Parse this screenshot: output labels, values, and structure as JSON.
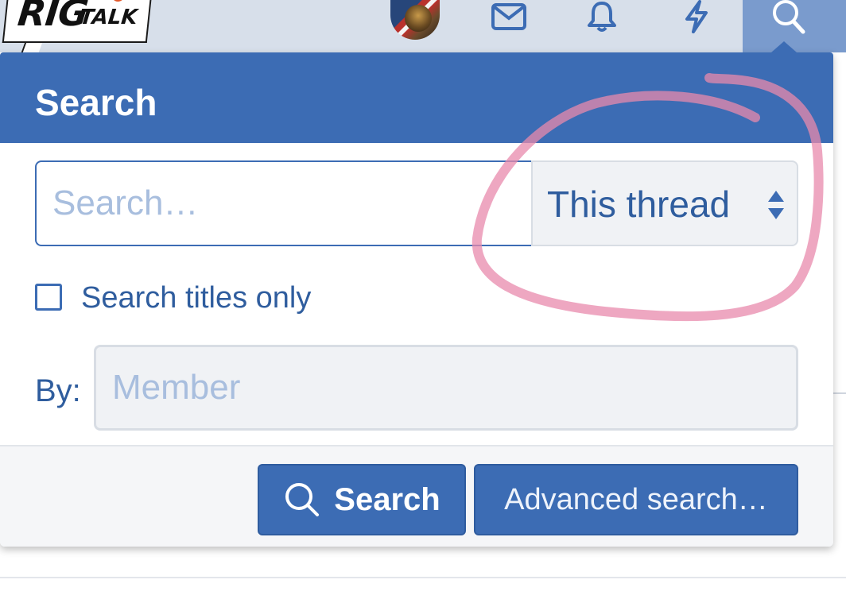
{
  "header": {
    "logo_primary": "RIG",
    "logo_secondary": "TALK",
    "nav_icons": [
      "avatar",
      "envelope-icon",
      "bell-icon",
      "lightning-icon",
      "search-icon"
    ]
  },
  "search_panel": {
    "title": "Search",
    "query_placeholder": "Search…",
    "scope_selected": "This thread",
    "titles_only_label": "Search titles only",
    "titles_only_checked": false,
    "by_label": "By:",
    "member_placeholder": "Member",
    "search_button_label": "Search",
    "advanced_button_label": "Advanced search…"
  },
  "colors": {
    "brand_blue": "#3c6cb4",
    "header_bg": "#d7dfea",
    "annotation_pink": "#e88aac"
  }
}
